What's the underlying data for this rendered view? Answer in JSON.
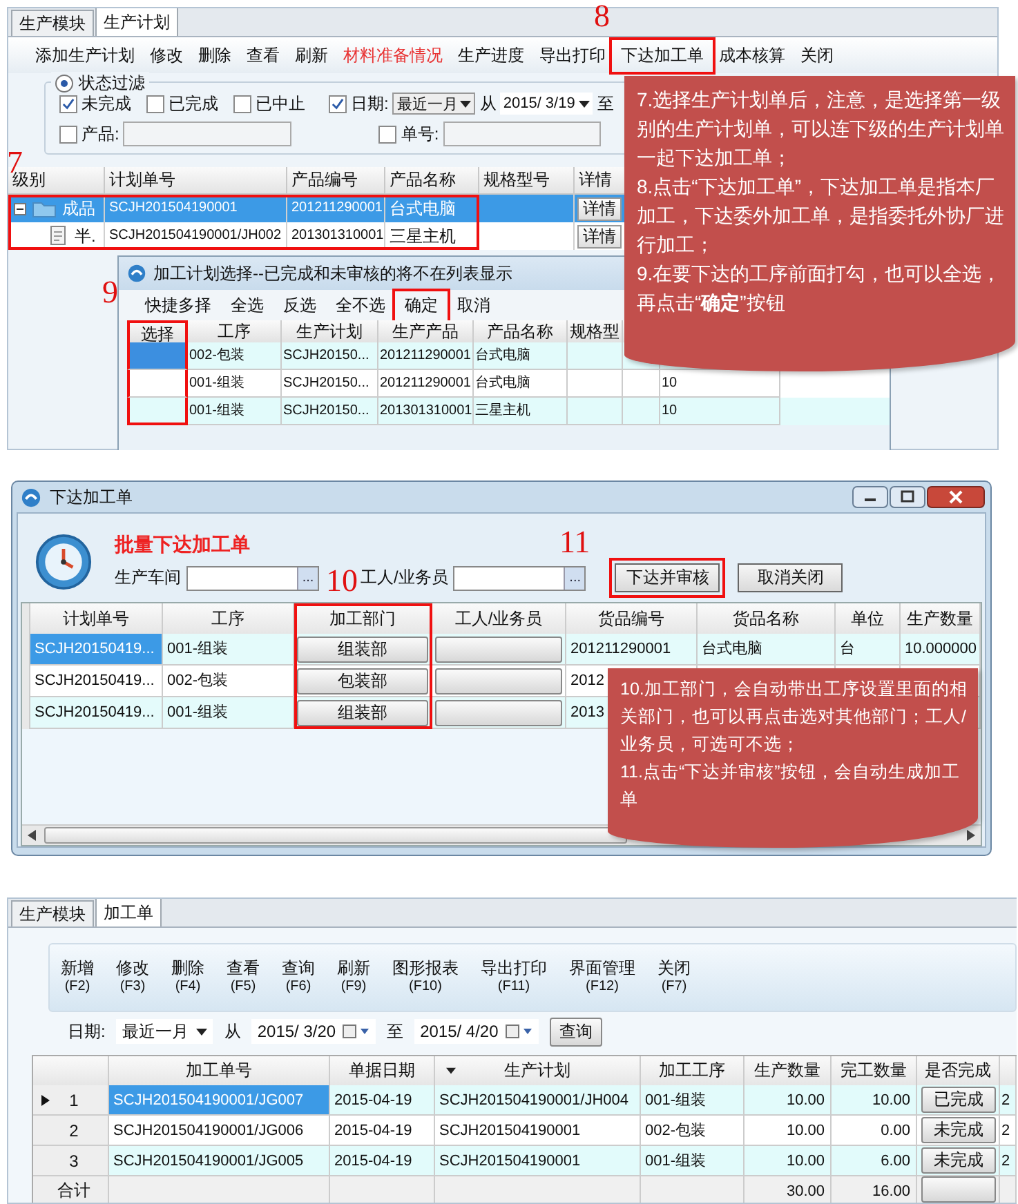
{
  "production_plan": {
    "tabs": [
      {
        "label": "生产模块",
        "selected": false
      },
      {
        "label": "生产计划",
        "selected": true
      }
    ],
    "toolbar": [
      {
        "label": "添加生产计划",
        "kind": "normal"
      },
      {
        "label": "修改",
        "kind": "normal"
      },
      {
        "label": "删除",
        "kind": "normal"
      },
      {
        "label": "查看",
        "kind": "normal"
      },
      {
        "label": "刷新",
        "kind": "normal"
      },
      {
        "label": "材料准备情况",
        "kind": "alert"
      },
      {
        "label": "生产进度",
        "kind": "normal"
      },
      {
        "label": "导出打印",
        "kind": "normal"
      },
      {
        "label": "下达加工单",
        "kind": "normal"
      },
      {
        "label": "成本核算",
        "kind": "normal"
      },
      {
        "label": "关闭",
        "kind": "normal"
      }
    ],
    "filter": {
      "mode": {
        "label": "状态过滤",
        "selected": true
      },
      "statuses": [
        {
          "label": "未完成",
          "checked": true
        },
        {
          "label": "已完成",
          "checked": false
        },
        {
          "label": "已中止",
          "checked": false
        }
      ],
      "date": {
        "label": "日期:",
        "checked": true,
        "range": "最近一月",
        "from_label": "从",
        "from": "2015/ 3/19",
        "to_label": "至"
      },
      "product": {
        "label": "产品:",
        "checked": false
      },
      "number": {
        "label": "单号:",
        "checked": false
      }
    },
    "table": {
      "columns": [
        "级别",
        "计划单号",
        "产品编号",
        "产品名称",
        "规格型号",
        "详情"
      ],
      "rows": [
        {
          "grade": "成品",
          "plan_no": "SCJH201504190001",
          "product_no": "201211290001",
          "product_name": "台式电脑",
          "detail": "详情",
          "selected": true,
          "expanded": true,
          "children": [
            {
              "grade": "半.",
              "plan_no": "SCJH201504190001/JH002",
              "product_no": "201301310001",
              "product_name": "三星主机",
              "detail": "详情",
              "selected": false
            }
          ]
        }
      ]
    },
    "dialog": {
      "title": "加工计划选择--已完成和未审核的将不在列表显示",
      "toolbar": [
        "快捷多择",
        "全选",
        "反选",
        "全不选",
        "确定",
        "取消"
      ],
      "columns": [
        "选择",
        "工序",
        "生产计划",
        "生产产品",
        "产品名称",
        "规格型"
      ],
      "rows": [
        {
          "selected": true,
          "process": "002-包装",
          "plan": "SCJH20150...",
          "product": "201211290001",
          "product_name": "台式电脑"
        },
        {
          "selected": false,
          "process": "001-组装",
          "plan": "SCJH20150...",
          "product": "201211290001",
          "product_name": "台式电脑",
          "column_7": "10"
        },
        {
          "selected": false,
          "process": "001-组装",
          "plan": "SCJH20150...",
          "product": "201301310001",
          "product_name": "三星主机",
          "column_7": "10"
        }
      ]
    },
    "callout": [
      "7.选择生产计划单后，注意，是选择第一级别的生产计划单，可以连下级的生产计划单一起下达加工单；",
      "8.点击“下达加工单”，下达加工单是指本厂加工，下达委外加工单，是指委托外协厂进行加工；",
      "9.在要下达的工序前面打勾，也可以全选，再点击“**确定**”按钮"
    ],
    "step_numbers": [
      "7",
      "8",
      "9"
    ]
  },
  "issue_window": {
    "title": "下达加工单",
    "heading": "批量下达加工单",
    "workshop": {
      "label": "生产车间",
      "browse": "..."
    },
    "worker": {
      "label": "工人/业务员",
      "browse": "..."
    },
    "buttons": [
      "下达并审核",
      "取消关闭"
    ],
    "columns": [
      "计划单号",
      "工序",
      "加工部门",
      "工人/业务员",
      "货品编号",
      "货品名称",
      "单位",
      "生产数量"
    ],
    "rows": [
      {
        "plan": "SCJH20150419...",
        "selected": true,
        "process": "001-组装",
        "department": "组装部",
        "goods_no": "201211290001",
        "goods_name": "台式电脑",
        "unit": "台",
        "quantity": "10.000000"
      },
      {
        "plan": "SCJH20150419...",
        "selected": false,
        "process": "002-包装",
        "department": "包装部",
        "goods_no": "2012"
      },
      {
        "plan": "SCJH20150419...",
        "selected": false,
        "process": "001-组装",
        "department": "组装部",
        "goods_no": "2013"
      }
    ],
    "callout": [
      "10.加工部门，会自动带出工序设置里面的相关部门，也可以再点击选对其他部门；工人/业务员，可选可不选；",
      "11.点击“下达并审核”按钮，会自动生成加工单"
    ],
    "step_numbers": [
      "10",
      "11"
    ]
  },
  "work_orders": {
    "tabs": [
      {
        "label": "生产模块",
        "selected": false
      },
      {
        "label": "加工单",
        "selected": true
      }
    ],
    "toolbar": [
      {
        "label": "新增",
        "key": "(F2)"
      },
      {
        "label": "修改",
        "key": "(F3)"
      },
      {
        "label": "删除",
        "key": "(F4)"
      },
      {
        "label": "查看",
        "key": "(F5)"
      },
      {
        "label": "查询",
        "key": "(F6)"
      },
      {
        "label": "刷新",
        "key": "(F9)"
      },
      {
        "label": "图形报表",
        "key": "(F10)"
      },
      {
        "label": "导出打印",
        "key": "(F11)"
      },
      {
        "label": "界面管理",
        "key": "(F12)"
      },
      {
        "label": "关闭",
        "key": "(F7)"
      }
    ],
    "filter": {
      "label": "日期:",
      "range": "最近一月",
      "from_label": "从",
      "from": "2015/ 3/20",
      "to_label": "至",
      "to": "2015/ 4/20",
      "button": "查询"
    },
    "columns": [
      {
        "label": "加工单号",
        "dropdown": false
      },
      {
        "label": "单据日期",
        "dropdown": false
      },
      {
        "label": "生产计划",
        "dropdown": true
      },
      {
        "label": "加工工序",
        "dropdown": false
      },
      {
        "label": "生产数量",
        "dropdown": false
      },
      {
        "label": "完工数量",
        "dropdown": false
      },
      {
        "label": "是否完成",
        "dropdown": false
      }
    ],
    "rows": [
      {
        "number": "1",
        "current": true,
        "selected": true,
        "order_no": "SCJH201504190001/JG007",
        "date": "2015-04-19",
        "plan": "SCJH201504190001/JH004",
        "process": "001-组装",
        "qty": "10.00",
        "done": "10.00",
        "status": "已完成",
        "column_9": "2"
      },
      {
        "number": "2",
        "current": false,
        "selected": false,
        "order_no": "SCJH201504190001/JG006",
        "date": "2015-04-19",
        "plan": "SCJH201504190001",
        "process": "002-包装",
        "qty": "10.00",
        "done": "0.00",
        "status": "未完成",
        "column_9": "2"
      },
      {
        "number": "3",
        "current": false,
        "selected": false,
        "order_no": "SCJH201504190001/JG005",
        "date": "2015-04-19",
        "plan": "SCJH201504190001",
        "process": "001-组装",
        "qty": "10.00",
        "done": "6.00",
        "status": "未完成",
        "column_9": "2"
      }
    ],
    "total": {
      "label": "合计",
      "qty": "30.00",
      "done": "16.00"
    }
  }
}
